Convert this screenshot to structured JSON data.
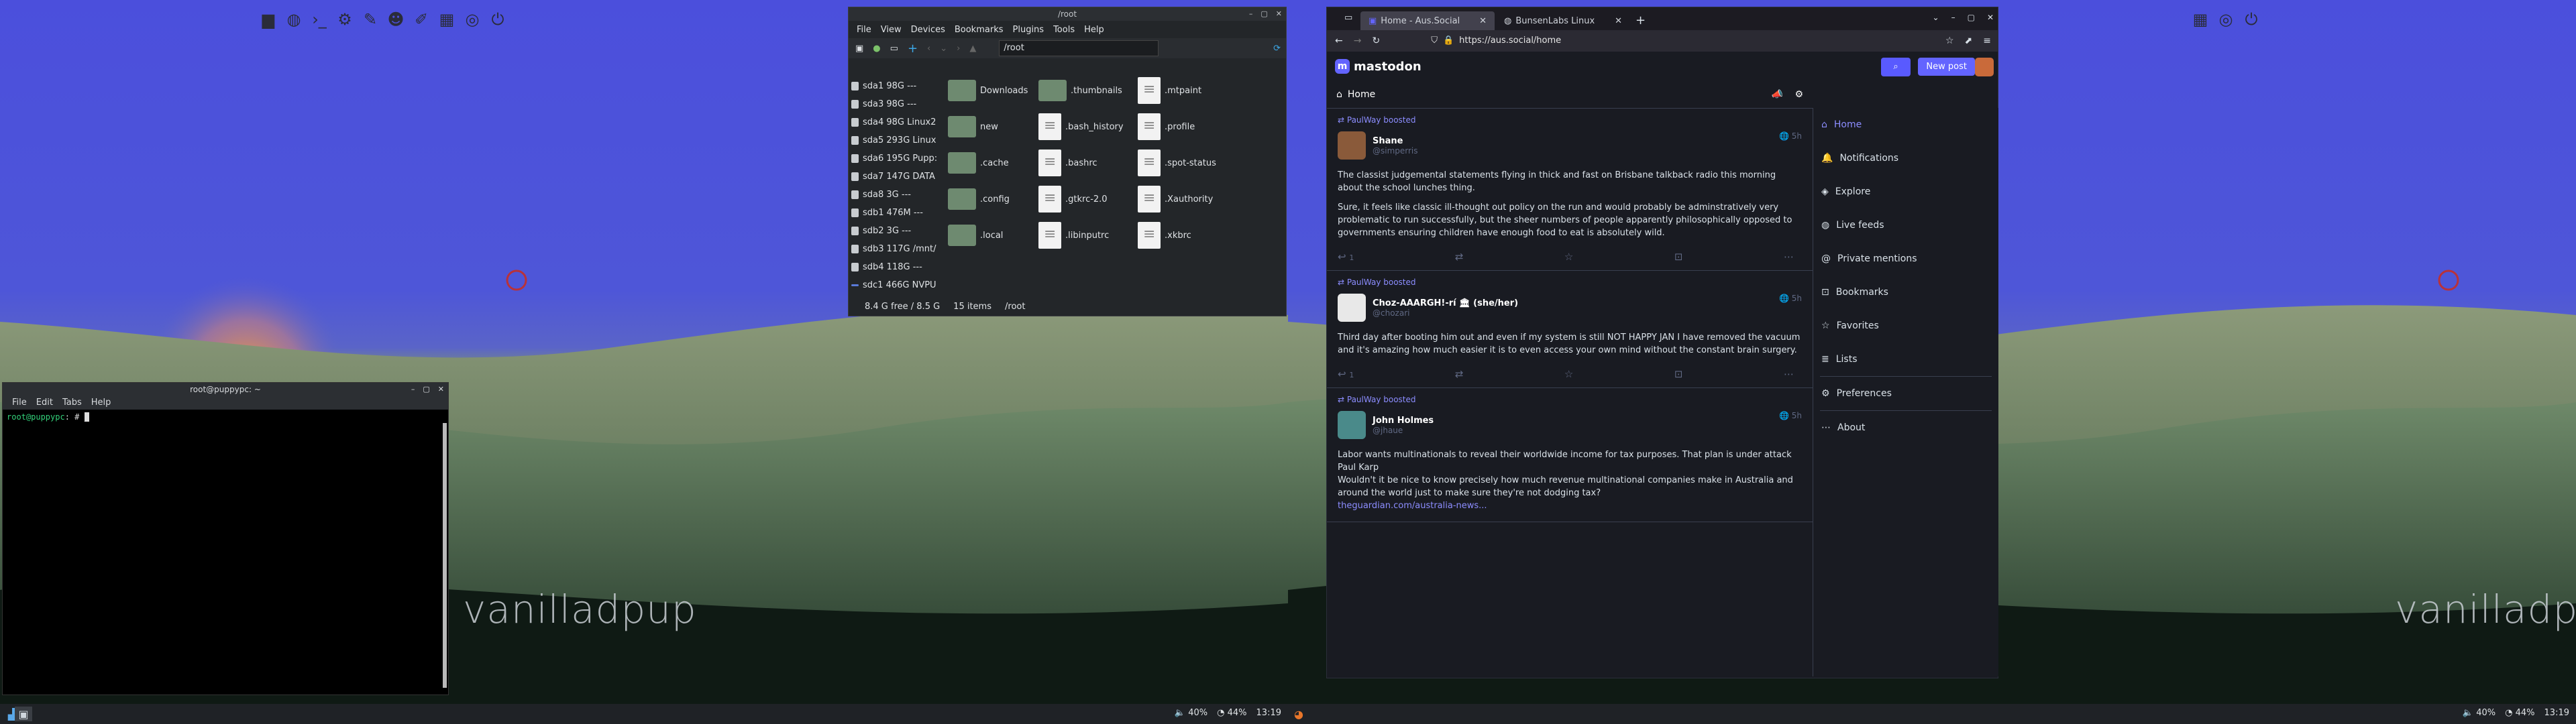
{
  "left_screen": {
    "watermark": "vanilladpup",
    "terminal": {
      "title": "root@puppypc: ~",
      "menu": [
        "File",
        "Edit",
        "Tabs",
        "Help"
      ],
      "prompt_user": "root@puppypc",
      "prompt_rest": ": # "
    },
    "file_manager": {
      "title": "/root",
      "menu": [
        "File",
        "View",
        "Devices",
        "Bookmarks",
        "Plugins",
        "Tools",
        "Help"
      ],
      "path": "/root",
      "drives": [
        "sda1 98G ---",
        "sda3 98G ---",
        "sda4 98G Linux2",
        "sda5 293G Linux",
        "sda6 195G Pupp:",
        "sda7 147G DATA",
        "sda8 3G ---",
        "sdb1 476M ---",
        "sdb2 3G ---",
        "sdb3 117G /mnt/",
        "sdb4 118G ---",
        "sdc1 466G NVPU"
      ],
      "items": [
        {
          "name": "Downloads",
          "type": "folder"
        },
        {
          "name": ".thumbnails",
          "type": "folder"
        },
        {
          "name": ".mtpaint",
          "type": "file"
        },
        {
          "name": "new",
          "type": "folder"
        },
        {
          "name": ".bash_history",
          "type": "file"
        },
        {
          "name": ".profile",
          "type": "file"
        },
        {
          "name": ".cache",
          "type": "folder"
        },
        {
          "name": ".bashrc",
          "type": "file"
        },
        {
          "name": ".spot-status",
          "type": "file"
        },
        {
          "name": ".config",
          "type": "folder"
        },
        {
          "name": ".gtkrc-2.0",
          "type": "file"
        },
        {
          "name": ".Xauthority",
          "type": "file"
        },
        {
          "name": ".local",
          "type": "folder"
        },
        {
          "name": ".libinputrc",
          "type": "file"
        },
        {
          "name": ".xkbrc",
          "type": "file"
        }
      ],
      "status_free": "8.4 G free / 8.5 G",
      "status_items": "15 items",
      "status_path": "/root"
    },
    "tray": {
      "volume": "40%",
      "wifi": "44%",
      "clock": "13:19"
    }
  },
  "right_screen": {
    "watermark": "vanilladpup",
    "browser": {
      "tabs": [
        {
          "label": "Home - Aus.Social",
          "active": true
        },
        {
          "label": "BunsenLabs Linux",
          "active": false
        }
      ],
      "url": "https://aus.social/home"
    },
    "mastodon": {
      "logo": "mastodon",
      "new_post": "New post",
      "column_title": "Home",
      "posts": [
        {
          "boosted": "PaulWay boosted",
          "name": "Shane",
          "handle": "@simperris",
          "time": "5h",
          "paragraphs": [
            "The classist judgemental statements flying in thick and fast on Brisbane talkback radio this morning about the school lunches thing.",
            "Sure, it feels like classic ill-thought out policy on the run and would probably be adminstratively very problematic to run successfully, but the sheer numbers of people apparently philosophically opposed to governments ensuring children have enough food to eat is absolutely wild."
          ],
          "replies": "1"
        },
        {
          "boosted": "PaulWay boosted",
          "name": "Choz-AAARGH!-rí 🏛 (she/her)",
          "handle": "@chozari",
          "time": "5h",
          "paragraphs": [
            "Third day after booting him out and even if my system is still NOT HAPPY JAN I have removed the vacuum and it's amazing how much easier it is to even access your own mind without the constant brain surgery."
          ],
          "replies": "1"
        },
        {
          "boosted": "PaulWay boosted",
          "name": "John Holmes",
          "handle": "@jhaue",
          "time": "5h",
          "paragraphs": [
            "Labor wants multinationals to reveal their worldwide income for tax purposes. That plan is under attack",
            "Paul Karp",
            "Wouldn't it be nice to know precisely how much revenue multinational companies make in Australia and around the world just to make sure they're not dodging tax?"
          ],
          "link": "theguardian.com/australia-news..."
        }
      ],
      "nav": [
        "Home",
        "Notifications",
        "Explore",
        "Live feeds",
        "Private mentions",
        "Bookmarks",
        "Favorites",
        "Lists",
        "Preferences",
        "About"
      ]
    },
    "tray": {
      "volume": "40%",
      "wifi": "44%",
      "clock": "13:19"
    }
  }
}
